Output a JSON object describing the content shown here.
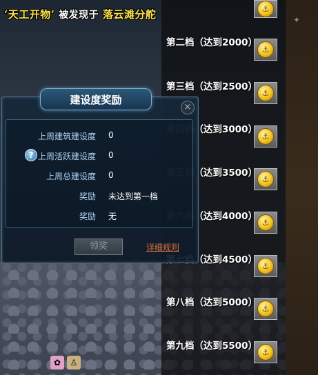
{
  "announcement": {
    "item": "‘天工开物’",
    "middle": "被发现于",
    "place": "落云滩分舵"
  },
  "dialog": {
    "title": "建设度奖励",
    "close_symbol": "×",
    "rows": [
      {
        "label": "上周建筑建设度",
        "value": "0"
      },
      {
        "label": "上周活跃建设度",
        "value": "0"
      },
      {
        "label": "上周总建设度",
        "value": "0"
      },
      {
        "label": "奖励",
        "value": "未达到第一档"
      },
      {
        "label": "奖励",
        "value": "无"
      }
    ],
    "claim_button": "领奖",
    "rules_link": "详细规则"
  },
  "tiers": [
    {
      "label": "第二档（达到2000）"
    },
    {
      "label": "第三档（达到2500）"
    },
    {
      "label": "第四档（达到3000）"
    },
    {
      "label": "第五档（达到3500）"
    },
    {
      "label": "第六档（达到4000）"
    },
    {
      "label": "第七档（达到4500）"
    },
    {
      "label": "第八档（达到5000）"
    },
    {
      "label": "第九档（达到5500）"
    }
  ],
  "icons": {
    "help": "help-icon",
    "coin": "gold-coin-icon",
    "bottom_1": "pink-flower-icon",
    "bottom_2": "character-icon"
  },
  "colors": {
    "announce_yellow": "#fde34a",
    "label_blue": "#a9d0ee",
    "link_orange": "#d8703d",
    "coin_gold": "#f2c21b"
  }
}
